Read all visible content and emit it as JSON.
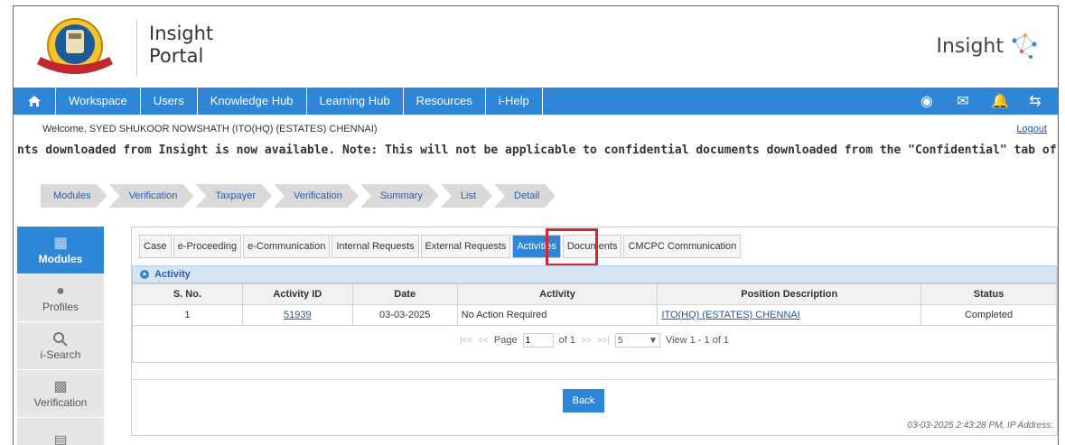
{
  "header": {
    "title": "Insight\nPortal",
    "brand": "Insight"
  },
  "nav": {
    "items": [
      "Workspace",
      "Users",
      "Knowledge Hub",
      "Learning Hub",
      "Resources",
      "i-Help"
    ]
  },
  "welcome": "Welcome, SYED SHUKOOR NOWSHATH (ITO(HQ) (ESTATES) CHENNAI)",
  "logout": "Logout",
  "marquee": "nts downloaded from Insight is now available. Note: This will not be applicable to confidential documents downloaded from the \"Confidential\" tab of Tax",
  "breadcrumb": [
    "Modules",
    "Verification",
    "Taxpayer",
    "Verification",
    "Summary",
    "List",
    "Detail"
  ],
  "leftnav": [
    "Modules",
    "Profiles",
    "i-Search",
    "Verification"
  ],
  "tabs": [
    "Case",
    "e-Proceeding",
    "e-Communication",
    "Internal Requests",
    "External Requests",
    "Activities",
    "Documents",
    "CMCPC Communication"
  ],
  "grid": {
    "caption": "Activity",
    "columns": [
      "S. No.",
      "Activity ID",
      "Date",
      "Activity",
      "Position Description",
      "Status"
    ],
    "rows": [
      {
        "sno": "1",
        "activity_id": "51939",
        "date": "03-03-2025",
        "activity": "No Action Required",
        "position": "ITO(HQ) (ESTATES) CHENNAI",
        "status": "Completed"
      }
    ],
    "pager": {
      "page_label": "Page",
      "page_value": "1",
      "of_label": "of 1",
      "rows_per_page": "5",
      "view_label": "View 1 - 1 of 1"
    }
  },
  "back_label": "Back",
  "footer_stamp": "03-03-2025 2:43:28 PM, IP Address:"
}
